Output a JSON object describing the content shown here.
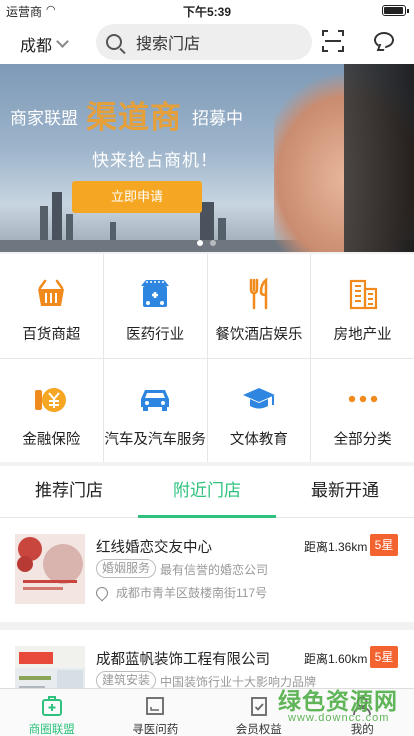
{
  "status_bar": {
    "carrier": "运营商",
    "time": "下午5:39"
  },
  "header": {
    "city": "成都",
    "search_placeholder": "搜索门店"
  },
  "banner": {
    "left_text": "商家联盟",
    "highlight_text": "渠道商",
    "right_text": "招募中",
    "subtitle": "快来抢占商机！",
    "button_label": "立即申请"
  },
  "categories": [
    {
      "label": "百货商超",
      "icon": "basket-icon"
    },
    {
      "label": "医药行业",
      "icon": "pharmacy-icon"
    },
    {
      "label": "餐饮酒店娱乐",
      "icon": "fork-knife-icon"
    },
    {
      "label": "房地产业",
      "icon": "building-icon"
    },
    {
      "label": "金融保险",
      "icon": "yen-coin-icon"
    },
    {
      "label": "汽车及汽车服务",
      "icon": "car-icon"
    },
    {
      "label": "文体教育",
      "icon": "graduation-cap-icon"
    },
    {
      "label": "全部分类",
      "icon": "more-dots-icon"
    }
  ],
  "tabs": [
    {
      "label": "推荐门店",
      "active": false
    },
    {
      "label": "附近门店",
      "active": true
    },
    {
      "label": "最新开通",
      "active": false
    }
  ],
  "stores": [
    {
      "name": "红线婚恋交友中心",
      "distance": "距离1.36km",
      "rating": "5星",
      "tag": "婚姻服务",
      "description": "最有信誉的婚恋公司",
      "address": "成都市青羊区鼓楼南街117号"
    },
    {
      "name": "成都蓝帆装饰工程有限公司",
      "distance": "距离1.60km",
      "rating": "5星",
      "tag": "建筑安装",
      "description": "中国装饰行业十大影响力品牌",
      "address": ""
    }
  ],
  "bottom_nav": [
    {
      "label": "商圈联盟",
      "active": true
    },
    {
      "label": "寻医问药",
      "active": false
    },
    {
      "label": "会员权益",
      "active": false
    },
    {
      "label": "我的",
      "active": false
    }
  ],
  "watermark": {
    "line1": "绿色资源网",
    "line2": "www.downcc.com"
  },
  "colors": {
    "accent": "#2ec27e",
    "star_badge": "#f2632f",
    "banner_button": "#f5a623",
    "icon_orange": "#f08a1c",
    "icon_blue": "#2f86e0"
  }
}
